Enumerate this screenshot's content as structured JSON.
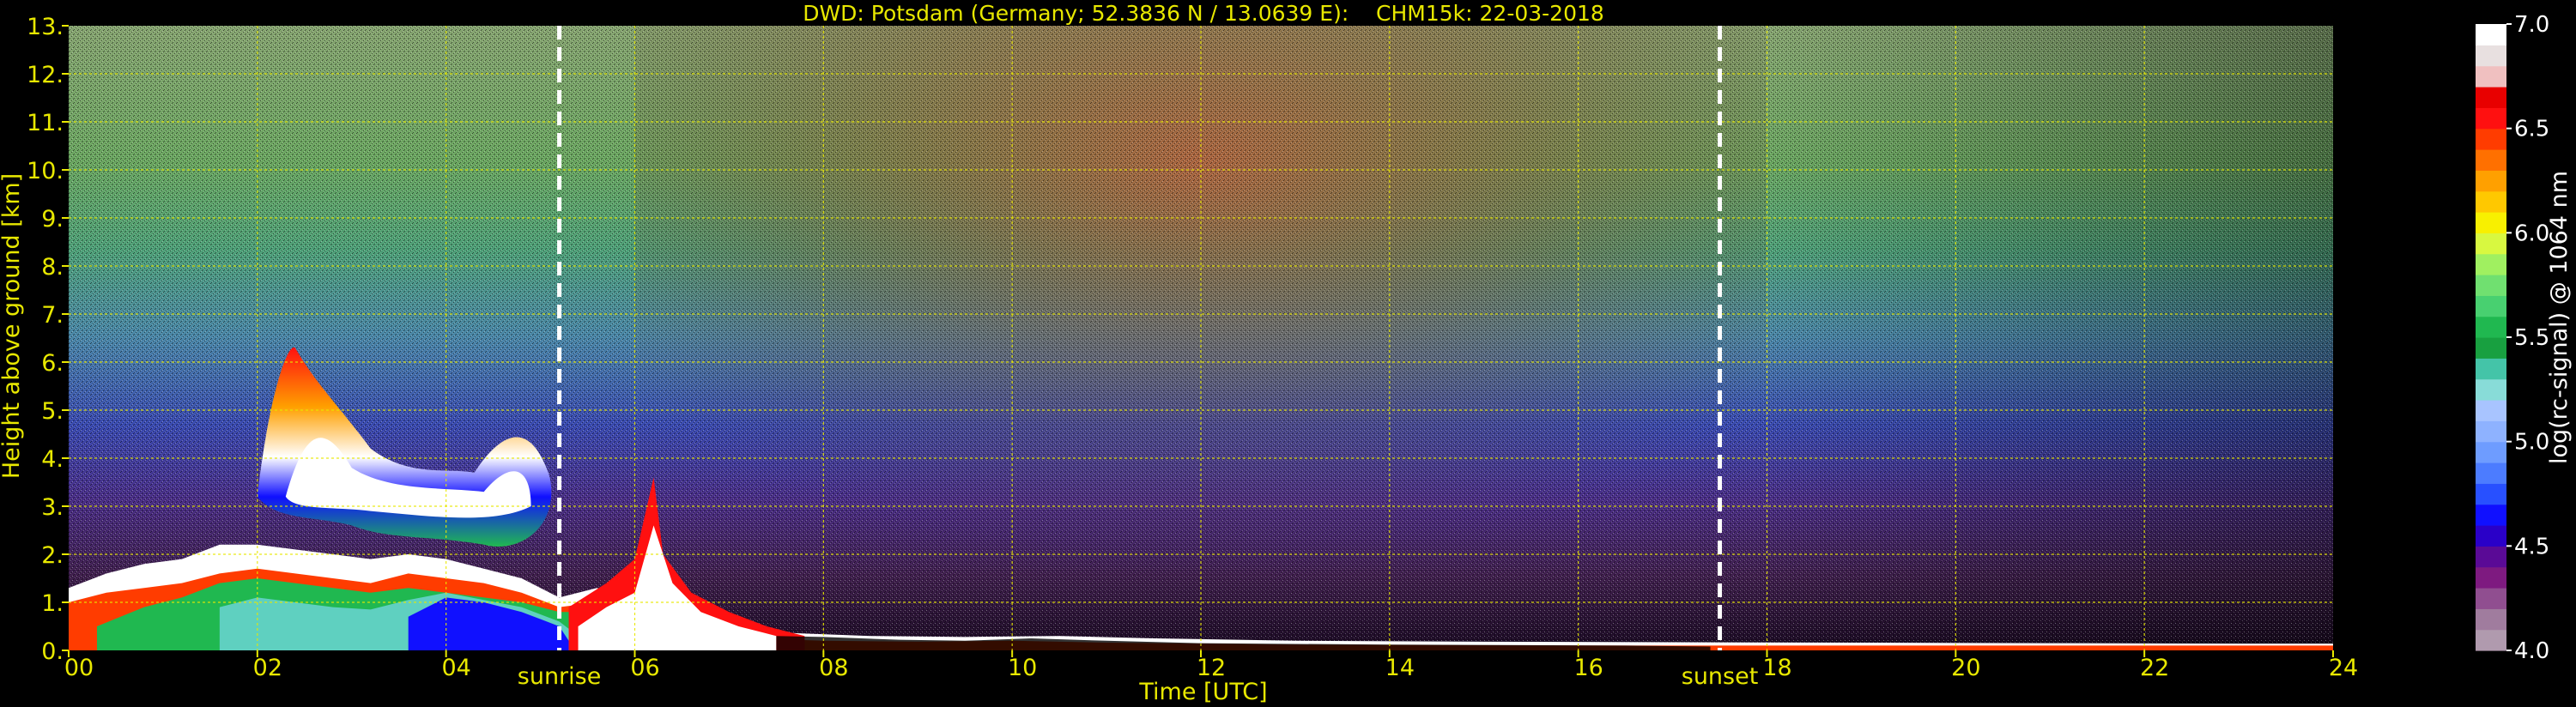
{
  "chart_data": {
    "type": "heatmap",
    "title": "DWD: Potsdam (Germany; 52.3836 N / 13.0639 E):    CHM15k: 22-03-2018",
    "xlabel": "Time [UTC]",
    "ylabel": "Height above ground [km]",
    "xlim": [
      0,
      24
    ],
    "ylim": [
      0,
      13
    ],
    "x_ticks": [
      0,
      2,
      4,
      6,
      8,
      10,
      12,
      14,
      16,
      18,
      20,
      22,
      24
    ],
    "x_tick_labels": [
      "00",
      "02",
      "04",
      "06",
      "08",
      "10",
      "12",
      "14",
      "16",
      "18",
      "20",
      "22",
      "24"
    ],
    "y_ticks": [
      0,
      1,
      2,
      3,
      4,
      5,
      6,
      7,
      8,
      9,
      10,
      11,
      12,
      13
    ],
    "y_tick_labels": [
      "0.",
      "1.",
      "2.",
      "3.",
      "4.",
      "5.",
      "6.",
      "7.",
      "8.",
      "9.",
      "10.",
      "11.",
      "12.",
      "13."
    ],
    "grid": true,
    "events": [
      {
        "label": "sunrise",
        "x": 5.2
      },
      {
        "label": "sunset",
        "x": 17.5
      }
    ],
    "colorbar": {
      "label": "log(rc-signal) @ 1064 nm",
      "range": [
        4.0,
        7.0
      ],
      "ticks": [
        4.0,
        4.5,
        5.0,
        5.5,
        6.0,
        6.5,
        7.0
      ],
      "tick_labels": [
        "4.0",
        "4.5",
        "5.0",
        "5.5",
        "6.0",
        "6.5",
        "7.0"
      ],
      "colors": [
        "#b09aae",
        "#a07c9e",
        "#904e90",
        "#7e1a80",
        "#5a0a96",
        "#2a00c8",
        "#1010ff",
        "#2850ff",
        "#4c7cff",
        "#6e9cff",
        "#8eb2ff",
        "#a8c4ff",
        "#88dcd8",
        "#44c4a8",
        "#18a040",
        "#20b850",
        "#48d070",
        "#70e070",
        "#a0f060",
        "#d8f840",
        "#f8f000",
        "#ffc800",
        "#ffa000",
        "#ff7000",
        "#ff3c00",
        "#ff1010",
        "#e80000",
        "#f0c0c0",
        "#e8e0e0",
        "#ffffff"
      ]
    },
    "colors": {
      "text_and_grid": "#e8e800",
      "background": "#000000",
      "event_line": "#ffffff"
    }
  }
}
